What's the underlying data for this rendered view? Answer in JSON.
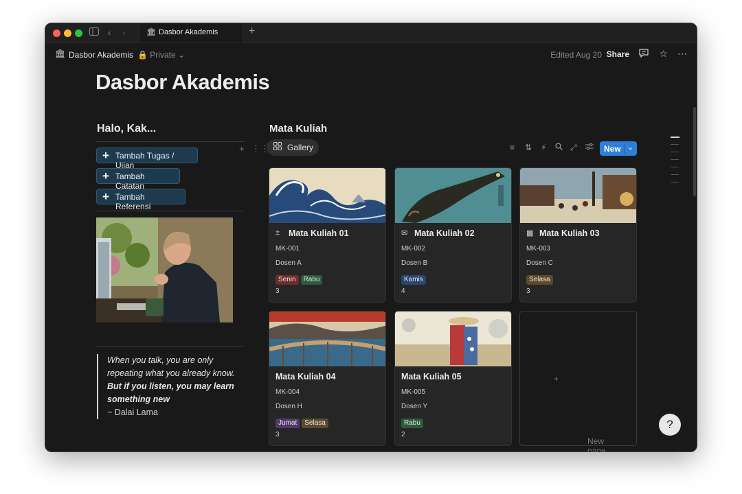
{
  "window": {
    "tab_title": "Dasbor Akademis"
  },
  "topbar": {
    "breadcrumb": "Dasbor Akademis",
    "privacy": "Private",
    "edited": "Edited Aug 20",
    "share": "Share"
  },
  "page": {
    "title": "Dasbor Akademis"
  },
  "left": {
    "heading": "Halo, Kak...",
    "buttons": [
      {
        "label": "Tambah Tugas / Ujian"
      },
      {
        "label": "Tambah Catatan"
      },
      {
        "label": "Tambah Referensi"
      }
    ],
    "quote": {
      "line1": "When you talk, you are only repeating what you already know.",
      "line2": "But if you listen, you may learn something new",
      "author": "~ Dalai Lama"
    }
  },
  "gallery": {
    "heading": "Mata Kuliah",
    "view_tab": "Gallery",
    "new_label": "New",
    "new_page": "New page",
    "cards": [
      {
        "title": "Mata Kuliah 01",
        "code": "MK-001",
        "dosen": "Dosen A",
        "tags": [
          {
            "label": "Senin",
            "color": "#6e2c2c"
          },
          {
            "label": "Rabu",
            "color": "#2c5a3a"
          }
        ],
        "count": "3"
      },
      {
        "title": "Mata Kuliah 02",
        "code": "MK-002",
        "dosen": "Dosen B",
        "tags": [
          {
            "label": "Kamis",
            "color": "#28456e"
          }
        ],
        "count": "4"
      },
      {
        "title": "Mata Kuliah 03",
        "code": "MK-003",
        "dosen": "Dosen C",
        "tags": [
          {
            "label": "Selasa",
            "color": "#5c4a2a"
          }
        ],
        "count": "3"
      },
      {
        "title": "Mata Kuliah 04",
        "code": "MK-004",
        "dosen": "Dosen H",
        "tags": [
          {
            "label": "Jumat",
            "color": "#4f3a6a"
          },
          {
            "label": "Selasa",
            "color": "#5c4a2a"
          }
        ],
        "count": "3"
      },
      {
        "title": "Mata Kuliah 05",
        "code": "MK-005",
        "dosen": "Dosen Y",
        "tags": [
          {
            "label": "Rabu",
            "color": "#2c5a3a"
          }
        ],
        "count": "2"
      }
    ]
  },
  "colors": {
    "accent_blue": "#2f7fd9",
    "background": "#191919",
    "card": "#262626"
  }
}
